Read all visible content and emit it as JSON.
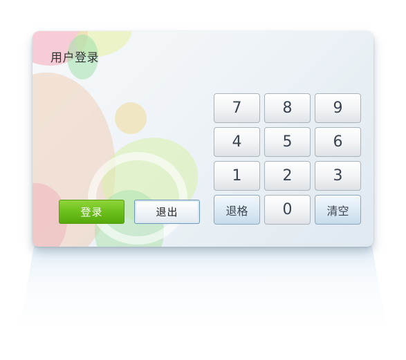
{
  "dialog": {
    "title": "用户登录"
  },
  "keypad": {
    "keys": [
      {
        "label": "7",
        "type": "digit"
      },
      {
        "label": "8",
        "type": "digit"
      },
      {
        "label": "9",
        "type": "digit"
      },
      {
        "label": "4",
        "type": "digit"
      },
      {
        "label": "5",
        "type": "digit"
      },
      {
        "label": "6",
        "type": "digit"
      },
      {
        "label": "1",
        "type": "digit"
      },
      {
        "label": "2",
        "type": "digit"
      },
      {
        "label": "3",
        "type": "digit"
      },
      {
        "label": "退格",
        "type": "backspace"
      },
      {
        "label": "0",
        "type": "digit"
      },
      {
        "label": "清空",
        "type": "clear"
      }
    ]
  },
  "actions": {
    "login_label": "登录",
    "exit_label": "退出"
  },
  "colors": {
    "login_green": "#6cc01b",
    "function_key_blue": "#d9e8f3",
    "text_dark": "#333333"
  }
}
